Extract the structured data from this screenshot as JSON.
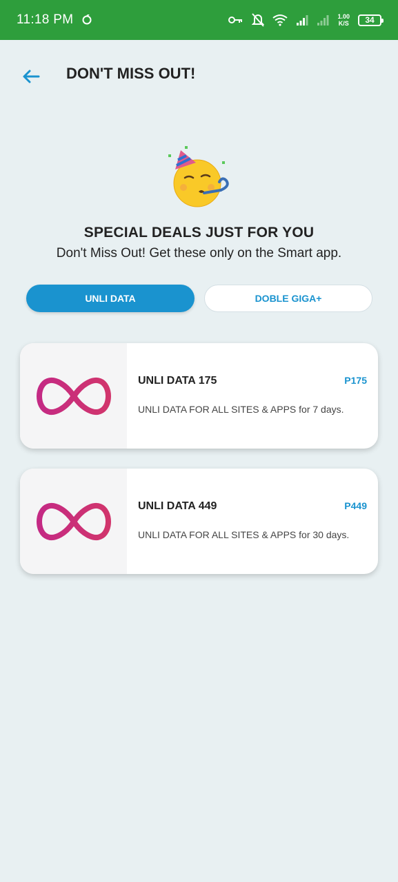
{
  "status_bar": {
    "time": "11:18 PM",
    "net_speed_value": "1.00",
    "net_speed_unit": "K/S",
    "battery": "34"
  },
  "header": {
    "title": "DON'T MISS OUT!"
  },
  "hero": {
    "title": "SPECIAL DEALS JUST FOR YOU",
    "subtitle": "Don't Miss Out! Get these only on the Smart app.",
    "emoji": "party-face-icon"
  },
  "tabs": [
    {
      "label": "UNLI DATA",
      "active": true
    },
    {
      "label": "DOBLE GIGA+",
      "active": false
    }
  ],
  "offers": [
    {
      "name": "UNLI DATA 175",
      "price": "P175",
      "description": "UNLI DATA FOR ALL SITES & APPS for 7 days.",
      "icon": "infinity-icon"
    },
    {
      "name": "UNLI DATA 449",
      "price": "P449",
      "description": "UNLI DATA FOR ALL SITES & APPS for 30 days.",
      "icon": "infinity-icon"
    }
  ],
  "colors": {
    "status_bar": "#2e9e3c",
    "accent": "#1a93cf",
    "background": "#e8f0f2",
    "infinity": "#c4307a"
  }
}
